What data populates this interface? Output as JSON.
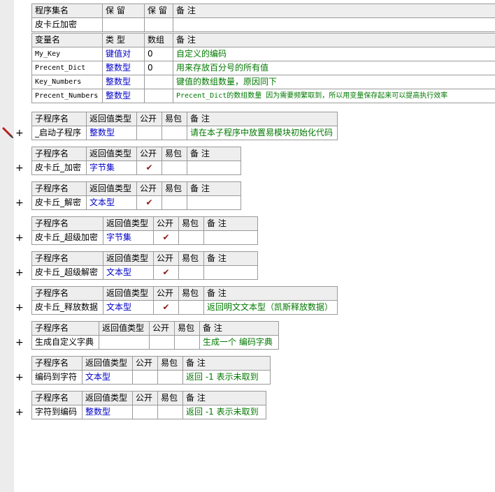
{
  "assembly": {
    "headers": [
      "程序集名",
      "保 留",
      "保 留",
      "备 注"
    ],
    "name": "皮卡丘加密"
  },
  "vars": {
    "headers": [
      "变量名",
      "类 型",
      "数组",
      "备 注"
    ],
    "rows": [
      {
        "name": "My_Key",
        "type": "键值对",
        "array": "0",
        "note": "自定义的编码"
      },
      {
        "name": "Precent_Dict",
        "type": "整数型",
        "array": "0",
        "note": "用来存放百分号的所有值"
      },
      {
        "name": "Key_Numbers",
        "type": "整数型",
        "array": "",
        "note": "键值的数组数量，原因同下"
      },
      {
        "name": "Precent_Numbers",
        "type": "整数型",
        "array": "",
        "note": "Precent_Dict的数组数量 因为需要频繁取到，所以用变量保存起来可以提高执行效率"
      }
    ]
  },
  "sub_headers": [
    "子程序名",
    "返回值类型",
    "公开",
    "易包",
    "备 注"
  ],
  "check_mark": "✔",
  "expand_symbol": "+",
  "subs": [
    {
      "name": "_启动子程序",
      "ret": "整数型",
      "public": false,
      "note": "请在本子程序中放置易模块初始化代码"
    },
    {
      "name": "皮卡丘_加密",
      "ret": "字节集",
      "public": true,
      "note": ""
    },
    {
      "name": "皮卡丘_解密",
      "ret": "文本型",
      "public": true,
      "note": ""
    },
    {
      "name": "皮卡丘_超级加密",
      "ret": "字节集",
      "public": true,
      "note": ""
    },
    {
      "name": "皮卡丘_超级解密",
      "ret": "文本型",
      "public": true,
      "note": ""
    },
    {
      "name": "皮卡丘_释放数据",
      "ret": "文本型",
      "public": true,
      "note": "返回明文文本型（凯斯释放数据）"
    },
    {
      "name": "生成自定义字典",
      "ret": "",
      "public": false,
      "note": "生成一个 编码字典"
    },
    {
      "name": "编码到字符",
      "ret": "文本型",
      "public": false,
      "note": " 返回 -1 表示未取到"
    },
    {
      "name": "字符到编码",
      "ret": "整数型",
      "public": false,
      "note": "返回 -1 表示未取到"
    }
  ]
}
